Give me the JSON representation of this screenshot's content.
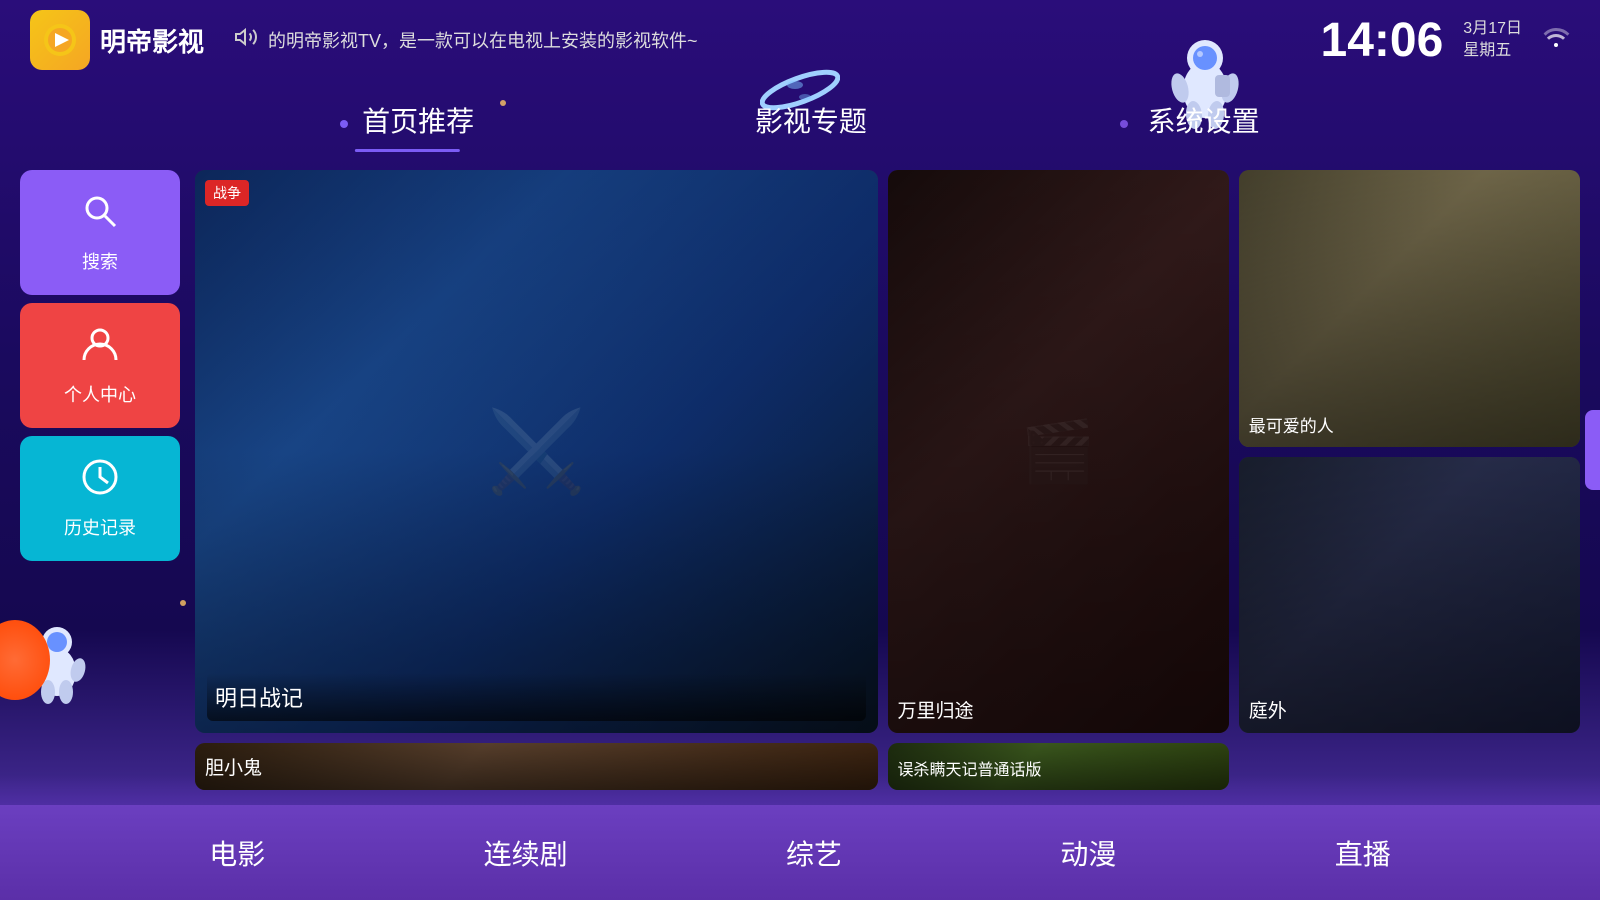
{
  "app": {
    "name": "明帝影视",
    "logo_char": "▶"
  },
  "header": {
    "marquee": "的明帝影视TV，是一款可以在电视上安装的影视软件~",
    "clock": "14:06",
    "date": "3月17日",
    "weekday": "星期五"
  },
  "nav": {
    "items": [
      {
        "id": "home",
        "label": "首页推荐",
        "active": true
      },
      {
        "id": "topics",
        "label": "影视专题",
        "active": false
      },
      {
        "id": "settings",
        "label": "系统设置",
        "active": false
      }
    ]
  },
  "sidebar": {
    "buttons": [
      {
        "id": "search",
        "label": "搜索",
        "icon": "🔍",
        "color": "#8b5cf6"
      },
      {
        "id": "personal",
        "label": "个人中心",
        "icon": "👤",
        "color": "#ef4444"
      },
      {
        "id": "history",
        "label": "历史记录",
        "icon": "🕐",
        "color": "#06b6d4"
      }
    ]
  },
  "media_cards": [
    {
      "id": "card1",
      "title": "明日战记",
      "span": "large",
      "gradient": "linear-gradient(135deg, #1a3a6e 0%, #2d5a9f 30%, #1e4080 60%, #0a1a3e 100%)"
    },
    {
      "id": "card2",
      "title": "万里归途",
      "span": "large-tall",
      "gradient": "linear-gradient(135deg, #2a1a1a 0%, #4a3030 40%, #3a2020 100%)"
    },
    {
      "id": "card3",
      "title": "最可爱的人",
      "span": "normal",
      "gradient": "linear-gradient(135deg, #4a4a3a 0%, #7a7a5a 40%, #5a5a3a 100%)"
    },
    {
      "id": "card4",
      "title": "庭外",
      "span": "normal",
      "gradient": "linear-gradient(135deg, #1a2a3a 0%, #2a3a5a 40%, #1a2a4a 100%)"
    },
    {
      "id": "card5",
      "title": "胆小鬼",
      "span": "normal",
      "gradient": "linear-gradient(135deg, #3a2a1a 0%, #6a4a2a 40%, #4a3a1a 100%)"
    },
    {
      "id": "card6",
      "title": "误杀瞒天记普通话版",
      "span": "normal",
      "gradient": "linear-gradient(135deg, #2a3a1a 0%, #4a6a2a 40%, #3a5a1a 100%)"
    }
  ],
  "bottom_nav": {
    "items": [
      {
        "id": "movie",
        "label": "电影",
        "active": false
      },
      {
        "id": "series",
        "label": "连续剧",
        "active": false
      },
      {
        "id": "variety",
        "label": "综艺",
        "active": false
      },
      {
        "id": "anime",
        "label": "动漫",
        "active": false
      },
      {
        "id": "live",
        "label": "直播",
        "active": false
      }
    ]
  },
  "decorations": {
    "planet_emoji": "🪐",
    "astronaut_emoji": "🧑‍🚀"
  }
}
